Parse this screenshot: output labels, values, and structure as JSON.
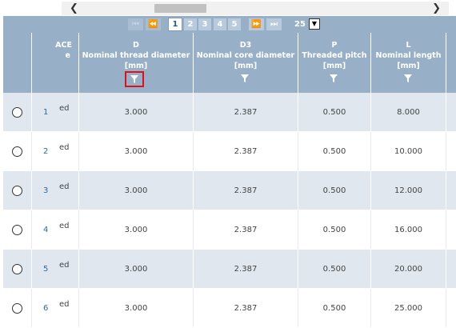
{
  "scrollbar": {
    "left_arrow": "❮",
    "right_arrow": "❯"
  },
  "pager": {
    "first": "⏮",
    "prev": "⏪",
    "pages": [
      "1",
      "2",
      "3",
      "4",
      "5"
    ],
    "active_page": "1",
    "next": "⏩",
    "last": "⏭",
    "page_size": "25",
    "page_size_arrow": "▼"
  },
  "columns": [
    {
      "symbol": "ACE",
      "desc": "e",
      "unit": ""
    },
    {
      "symbol": "D",
      "desc": "Nominal thread diameter",
      "unit": "[mm]"
    },
    {
      "symbol": "D3",
      "desc": "Nominal core diameter",
      "unit": "[mm]"
    },
    {
      "symbol": "P",
      "desc": "Threaded pitch",
      "unit": "[mm]"
    },
    {
      "symbol": "L",
      "desc": "Nominal length",
      "unit": "[mm]"
    }
  ],
  "rows": [
    {
      "index": "1",
      "frag": "ed",
      "d": "3.000",
      "d3": "2.387",
      "p": "0.500",
      "l": "8.000"
    },
    {
      "index": "2",
      "frag": "ed",
      "d": "3.000",
      "d3": "2.387",
      "p": "0.500",
      "l": "10.000"
    },
    {
      "index": "3",
      "frag": "ed",
      "d": "3.000",
      "d3": "2.387",
      "p": "0.500",
      "l": "12.000"
    },
    {
      "index": "4",
      "frag": "ed",
      "d": "3.000",
      "d3": "2.387",
      "p": "0.500",
      "l": "16.000"
    },
    {
      "index": "5",
      "frag": "ed",
      "d": "3.000",
      "d3": "2.387",
      "p": "0.500",
      "l": "20.000"
    },
    {
      "index": "6",
      "frag": "ed",
      "d": "3.000",
      "d3": "2.387",
      "p": "0.500",
      "l": "25.000"
    }
  ],
  "colors": {
    "header_bg": "#97b0c7",
    "row_alt_bg": "#e0e7ef",
    "highlight": "#e0101a",
    "link": "#2b6aa0"
  },
  "icons": {
    "filter": "funnel-icon"
  }
}
